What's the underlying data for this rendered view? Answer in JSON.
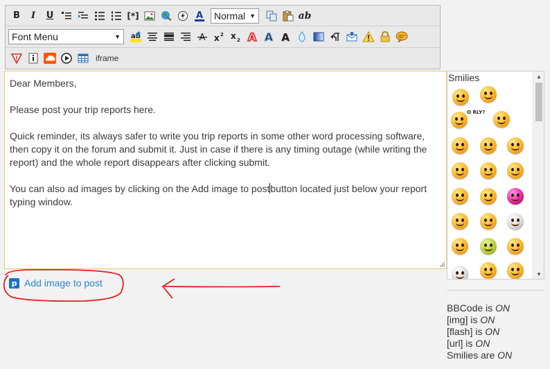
{
  "toolbar": {
    "row1": {
      "bold": "B",
      "italic": "I",
      "underline": "U",
      "code_label": "[*]",
      "font_size_select": "Normal",
      "remove_format": "ab"
    },
    "row2": {
      "font_select": "Font Menu"
    },
    "row3": {
      "iframe_label": "iframe"
    }
  },
  "editor": {
    "paragraphs": [
      "Dear Members,",
      "Please post your trip reports here.",
      "Quick reminder, its always safer to write you trip reports in some other word processing software, then copy it on the forum and submit it. Just in case if there is any timing outage (while writing the report) and the whole report disappears after clicking submit.",
      "You can also ad images by clicking on the Add image to post"
    ],
    "paragraph4_tail": "button located just below your report typing window."
  },
  "smilies": {
    "title": "Smilies",
    "orly_text": "O RLY?"
  },
  "add_image": {
    "label": "Add image to post",
    "icon_glyph": "p"
  },
  "bbcode_info": {
    "bbcode_prefix": "BBCode is ",
    "bbcode_state": "ON",
    "img_prefix": "[img] is ",
    "img_state": "ON",
    "flash_prefix": "[flash] is ",
    "flash_state": "ON",
    "url_prefix": "[url] is ",
    "url_state": "ON",
    "smilies_prefix": "Smilies are ",
    "smilies_state": "ON"
  },
  "colors": {
    "link": "#2a86d0",
    "annotation_red": "#e02020",
    "editor_border": "#e8c96a"
  }
}
